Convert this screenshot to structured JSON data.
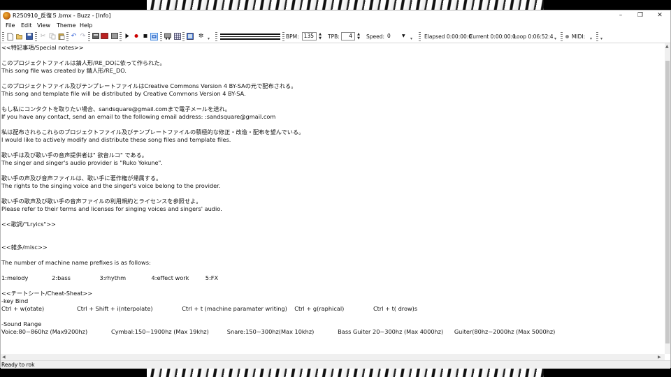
{
  "window": {
    "title": "R250910_反復５.bmx - Buzz - [Info]",
    "minimize_glyph": "–",
    "maximize_glyph": "❐",
    "close_glyph": "✕"
  },
  "menu": [
    "File",
    "Edit",
    "View",
    "Theme",
    "Help"
  ],
  "toolbar": {
    "icons": [
      "new-icon",
      "open-icon",
      "save-icon",
      "cut-icon",
      "copy-icon",
      "paste-icon",
      "undo-icon",
      "redo-icon",
      "machine-view-icon",
      "pattern-view-icon",
      "sequence-view-icon",
      "play-icon",
      "record-icon",
      "stop-icon",
      "loop-icon",
      "mixer-icon",
      "grid-icon",
      "info-icon",
      "cpu-icon"
    ],
    "bpm_label": "BPM:",
    "bpm_value": "135",
    "tpb_label": "TPB:",
    "tpb_value": "4",
    "speed_label": "Speed:",
    "speed_value": "0",
    "elapsed": "Elapsed 0:00:00:0",
    "current": "Current 0:00:00:0",
    "loop": "Loop 0:06:52:4",
    "midi_label": "MIDI:"
  },
  "document": {
    "lines": [
      "<<特記事項/Special notes>>",
      "",
      "このプロジェクトファイルは錆人形/RE_DOに依って作られた。",
      "This song file was created by 錆人形/RE_DO.",
      "",
      "このプロジェクトファイル及びテンプレートファイルはCreative Commons Version 4 BY-SAの元で配布される。",
      "This song and template file will be distributed by Creative Commons Version 4 BY-SA.",
      "",
      "もし私にコンタクトを取りたい場合、sandsquare@gmail.comまで電子メールを送れ。",
      "If you have any contact, send an email to the following email address: :sandsquare@gmail.com",
      "",
      "私は配布されらこれらのプロジェクトファイル及びテンプレートファイルの積極的な修正・改造・配布を望んでいる。",
      "I would like to actively modify and distribute these song files and template files.",
      "",
      "歌い手は及び歌い手の音声提供者は\" 欲音ルコ\" である。",
      "The singer and singer's audio provider is \"Ruko Yokune\".",
      "",
      "歌い手の声及び音声ファイルは、歌い手に著作権が帰属する。",
      "The rights to the singing voice and the singer's voice belong to the provider.",
      "",
      "歌い手の歌声及び歌い手の音声ファイルの利用規約とライセンスを参照せよ。",
      "Please refer to their terms and licenses for singing voices and singers' audio.",
      "",
      "<<歌詞/\"Lryics\">>",
      "",
      "",
      "<<雑多/misc>>",
      "",
      "The number of machine name prefixes is as follows:",
      "",
      "1:melody             2:bass                3:rhythm              4:effect work         5:FX",
      "",
      "<<チートシート/Cheat-Sheat>>",
      "-key Bind",
      "Ctrl + w(otate)                  Ctrl + Shift + i(nterpolate)                Ctrl + t (machine paramater writing)    Ctrl + g(raphical)                Ctrl + t( drow)s",
      "",
      "-Sound Range",
      "Voice:80~860hz (Max9200hz)             Cymbal:150~1900hz (Max 19khz)          Snare:150~300hz(Max 10khz)             Bass Guiter 20~300hz (Max 4000hz)      Guiter(80hz~2000hz (Max 5000hz)"
    ]
  },
  "status": {
    "text": "Ready to rok"
  }
}
